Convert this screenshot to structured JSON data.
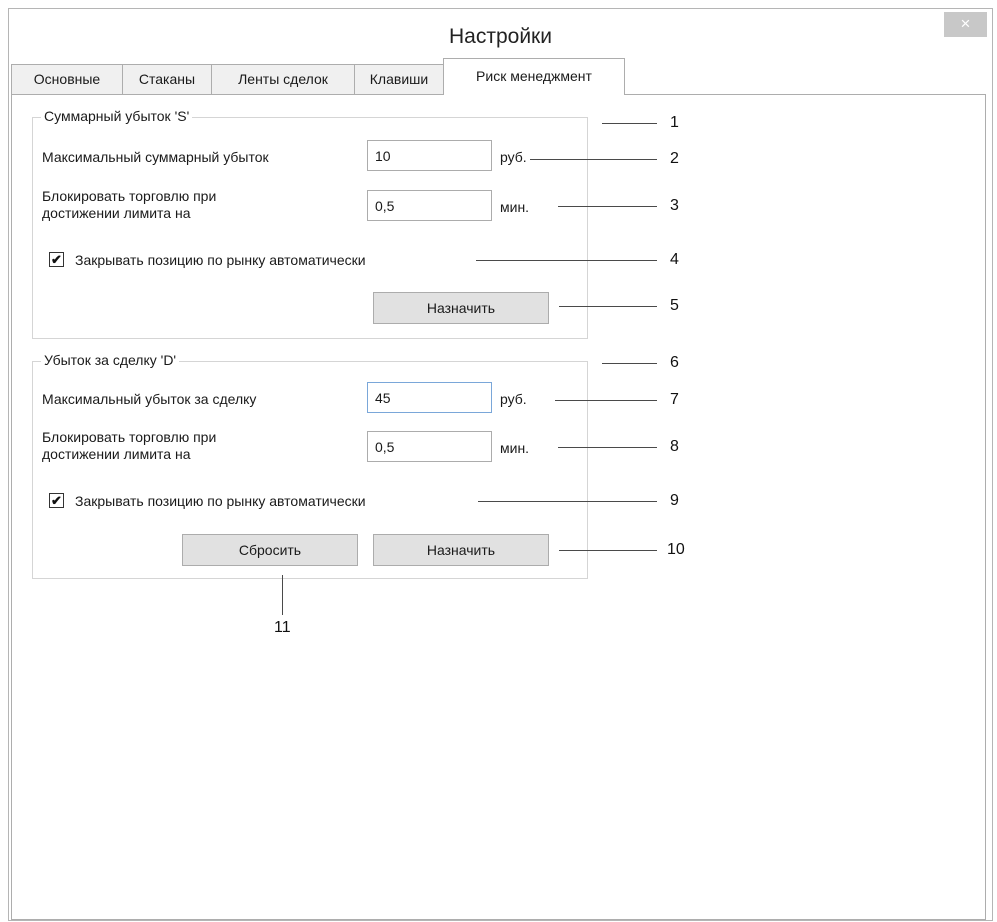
{
  "window": {
    "title": "Настройки",
    "close_icon": "×"
  },
  "tabs": [
    {
      "label": "Основные"
    },
    {
      "label": "Стаканы"
    },
    {
      "label": "Ленты сделок"
    },
    {
      "label": "Клавиши"
    },
    {
      "label": "Риск менеджмент",
      "active": true
    }
  ],
  "group_s": {
    "legend": "Суммарный убыток 'S'",
    "max_loss_label": "Максимальный суммарный убыток",
    "max_loss_value": "10",
    "max_loss_unit": "руб.",
    "block_label_line1": "Блокировать торговлю при",
    "block_label_line2": "достижении лимита на",
    "block_value": "0,5",
    "block_unit": "мин.",
    "autoclose_label": "Закрывать позицию по рынку автоматически",
    "autoclose_checked": true,
    "assign_label": "Назначить"
  },
  "group_d": {
    "legend": "Убыток за сделку 'D'",
    "max_loss_label": "Максимальный убыток за сделку",
    "max_loss_value": "45",
    "max_loss_unit": "руб.",
    "block_label_line1": "Блокировать торговлю при",
    "block_label_line2": "достижении лимита на",
    "block_value": "0,5",
    "block_unit": "мин.",
    "autoclose_label": "Закрывать позицию по рынку автоматически",
    "autoclose_checked": true,
    "reset_label": "Сбросить",
    "assign_label": "Назначить"
  },
  "callouts": [
    "1",
    "2",
    "3",
    "4",
    "5",
    "6",
    "7",
    "8",
    "9",
    "10",
    "11"
  ],
  "check_glyph": "✔"
}
